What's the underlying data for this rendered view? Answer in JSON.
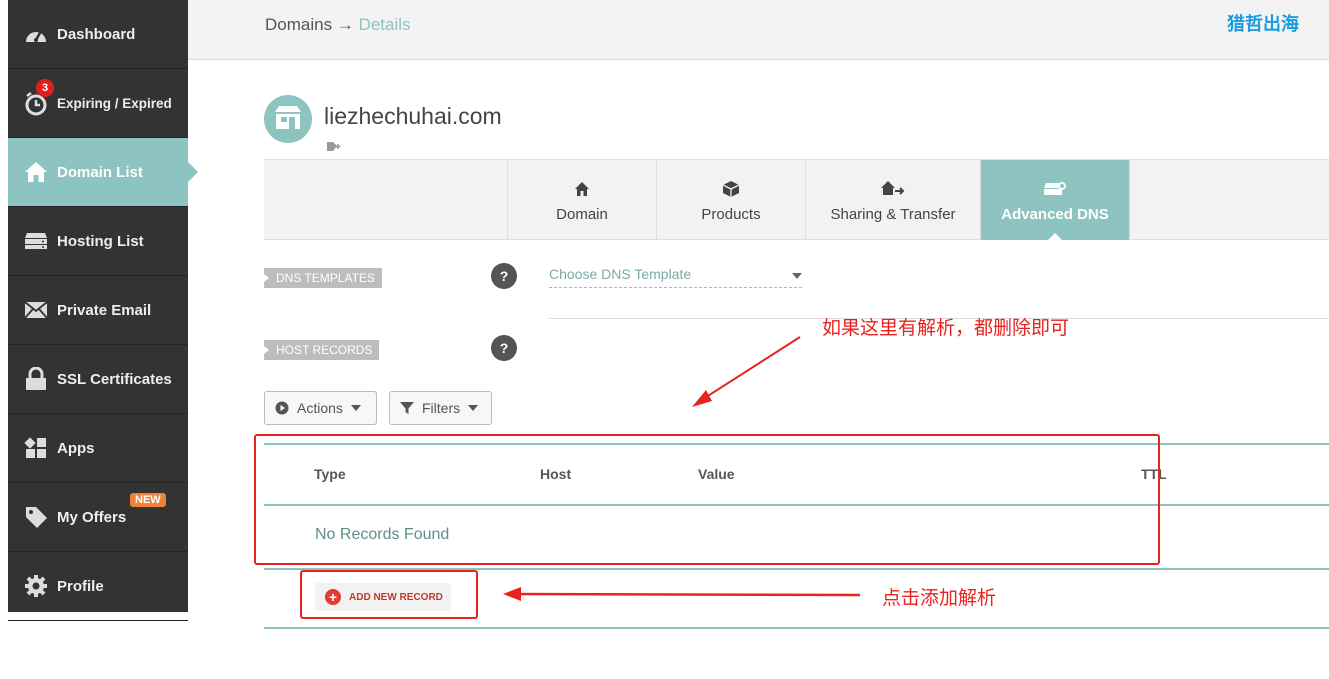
{
  "sidebar": {
    "items": [
      {
        "label": "Dashboard",
        "icon": "gauge-icon"
      },
      {
        "label": "Expiring / Expired",
        "icon": "alarm-clock-icon",
        "badge": "3"
      },
      {
        "label": "Domain List",
        "icon": "home-icon",
        "active": true
      },
      {
        "label": "Hosting List",
        "icon": "server-icon"
      },
      {
        "label": "Private Email",
        "icon": "envelope-icon"
      },
      {
        "label": "SSL Certificates",
        "icon": "lock-icon"
      },
      {
        "label": "Apps",
        "icon": "apps-icon"
      },
      {
        "label": "My Offers",
        "icon": "tag-icon",
        "badge": "NEW"
      },
      {
        "label": "Profile",
        "icon": "gear-icon"
      }
    ]
  },
  "header": {
    "breadcrumb_root": "Domains",
    "breadcrumb_sep": "→",
    "breadcrumb_current": "Details",
    "brand": "猎哲出海"
  },
  "domain": {
    "name": "liezhechuhai.com"
  },
  "tabs": [
    {
      "label": "Domain",
      "icon": "home-icon"
    },
    {
      "label": "Products",
      "icon": "box-icon"
    },
    {
      "label": "Sharing & Transfer",
      "icon": "share-icon"
    },
    {
      "label": "Advanced DNS",
      "icon": "dns-icon",
      "active": true
    }
  ],
  "dns_templates": {
    "label": "DNS TEMPLATES",
    "help": "?",
    "select_value": "Choose DNS Template"
  },
  "host_records": {
    "label": "HOST RECORDS",
    "help": "?",
    "actions_label": "Actions",
    "filters_label": "Filters",
    "columns": [
      "Type",
      "Host",
      "Value",
      "TTL"
    ],
    "empty_message": "No Records Found",
    "add_label": "ADD NEW RECORD"
  },
  "annotations": {
    "delete_note": "如果这里有解析，都删除即可",
    "add_note": "点击添加解析"
  },
  "colors": {
    "accent": "#8dc3c0",
    "sidebar_bg": "#333333",
    "annotation_red": "#e8231f"
  }
}
